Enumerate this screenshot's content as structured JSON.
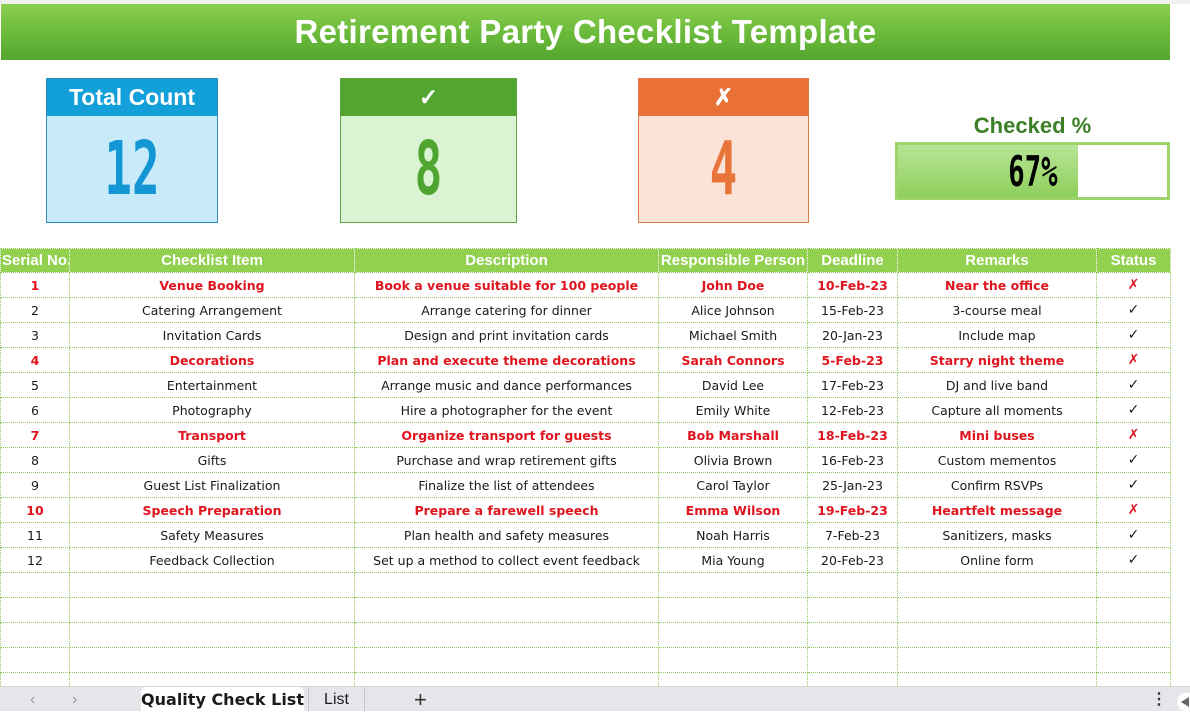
{
  "title": "Retirement Party Checklist Template",
  "summary": {
    "total": {
      "label": "Total Count",
      "value": "12",
      "color": "#139fd8"
    },
    "checked": {
      "label": "✓",
      "value": "8",
      "color": "#52a52f"
    },
    "unchecked": {
      "label": "✗",
      "value": "4",
      "color": "#ea7135"
    },
    "checked_pct": {
      "label": "Checked %",
      "value_text": "67%",
      "fraction": 0.67
    }
  },
  "table": {
    "columns": [
      "Serial No.",
      "Checklist Item",
      "Description",
      "Responsible Person",
      "Deadline",
      "Remarks",
      "Status"
    ],
    "rows": [
      {
        "serial": "1",
        "item": "Venue Booking",
        "description": "Book a venue suitable for 100 people",
        "person": "John Doe",
        "deadline": "10-Feb-23",
        "remarks": "Near the office",
        "status": "✗",
        "done": false
      },
      {
        "serial": "2",
        "item": "Catering Arrangement",
        "description": "Arrange catering for dinner",
        "person": "Alice Johnson",
        "deadline": "15-Feb-23",
        "remarks": "3-course meal",
        "status": "✓",
        "done": true
      },
      {
        "serial": "3",
        "item": "Invitation Cards",
        "description": "Design and print invitation cards",
        "person": "Michael Smith",
        "deadline": "20-Jan-23",
        "remarks": "Include map",
        "status": "✓",
        "done": true
      },
      {
        "serial": "4",
        "item": "Decorations",
        "description": "Plan and execute theme decorations",
        "person": "Sarah Connors",
        "deadline": "5-Feb-23",
        "remarks": "Starry night theme",
        "status": "✗",
        "done": false
      },
      {
        "serial": "5",
        "item": "Entertainment",
        "description": "Arrange music and dance performances",
        "person": "David Lee",
        "deadline": "17-Feb-23",
        "remarks": "DJ and live band",
        "status": "✓",
        "done": true
      },
      {
        "serial": "6",
        "item": "Photography",
        "description": "Hire a photographer for the event",
        "person": "Emily White",
        "deadline": "12-Feb-23",
        "remarks": "Capture all moments",
        "status": "✓",
        "done": true
      },
      {
        "serial": "7",
        "item": "Transport",
        "description": "Organize transport for guests",
        "person": "Bob Marshall",
        "deadline": "18-Feb-23",
        "remarks": "Mini buses",
        "status": "✗",
        "done": false
      },
      {
        "serial": "8",
        "item": "Gifts",
        "description": "Purchase and wrap retirement gifts",
        "person": "Olivia Brown",
        "deadline": "16-Feb-23",
        "remarks": "Custom mementos",
        "status": "✓",
        "done": true
      },
      {
        "serial": "9",
        "item": "Guest List Finalization",
        "description": "Finalize the list of attendees",
        "person": "Carol Taylor",
        "deadline": "25-Jan-23",
        "remarks": "Confirm RSVPs",
        "status": "✓",
        "done": true
      },
      {
        "serial": "10",
        "item": "Speech Preparation",
        "description": "Prepare a farewell speech",
        "person": "Emma Wilson",
        "deadline": "19-Feb-23",
        "remarks": "Heartfelt message",
        "status": "✗",
        "done": false
      },
      {
        "serial": "11",
        "item": "Safety Measures",
        "description": "Plan health and safety measures",
        "person": "Noah Harris",
        "deadline": "7-Feb-23",
        "remarks": "Sanitizers, masks",
        "status": "✓",
        "done": true
      },
      {
        "serial": "12",
        "item": "Feedback Collection",
        "description": "Set up a method to collect event feedback",
        "person": "Mia Young",
        "deadline": "20-Feb-23",
        "remarks": "Online form",
        "status": "✓",
        "done": true
      }
    ],
    "empty_rows": 5
  },
  "sheet_tabs": {
    "prev_icon": "chevron-left-icon",
    "next_icon": "chevron-right-icon",
    "tabs": [
      {
        "label": "Quality Check List",
        "active": true
      },
      {
        "label": "List",
        "active": false
      }
    ],
    "add_label": "+",
    "more_label": "⋮"
  }
}
